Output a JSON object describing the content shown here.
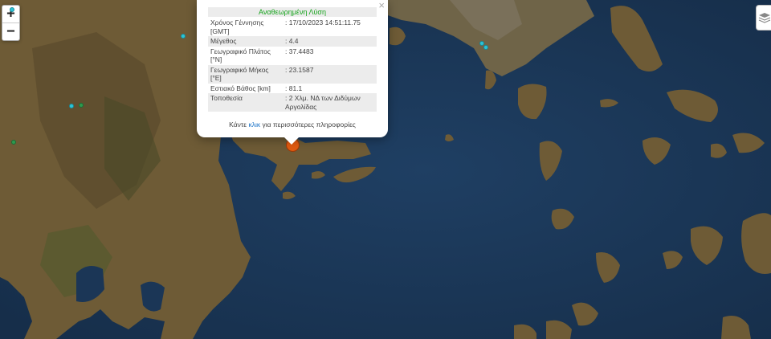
{
  "map": {
    "colors": {
      "sea": "#1d3a5c",
      "land": "#6b5a38",
      "green": "#3f4a26"
    },
    "zoom_in_label": "+",
    "zoom_out_label": "−",
    "layers_icon": "layers-icon"
  },
  "popup": {
    "title": "Αναθεωρημένη Λύση",
    "close_label": "×",
    "rows": [
      {
        "key": "Χρόνος Γέννησης [GMT]",
        "value": ": 17/10/2023 14:51:11.75"
      },
      {
        "key": "Μέγεθος",
        "value": ": 4.4"
      },
      {
        "key": "Γεωγραφικό Πλάτος [°N]",
        "value": ": 37.4483"
      },
      {
        "key": "Γεωγραφικό Μήκος [°E]",
        "value": ": 23.1587"
      },
      {
        "key": "Εστιακό Βάθος [km]",
        "value": ": 81.1"
      },
      {
        "key": "Τοποθεσία",
        "value": ": 2 Χλμ. ΝΔ των Διδύμων Αργολίδας"
      }
    ],
    "more_prefix": "Κάντε",
    "more_link": "κλικ",
    "more_suffix": "για περισσότερες πληροφορίες"
  },
  "markers": {
    "main_color": "#e05a10",
    "small_colors": {
      "cyan": "#2bc4d6",
      "green": "#2e9a4e"
    }
  }
}
